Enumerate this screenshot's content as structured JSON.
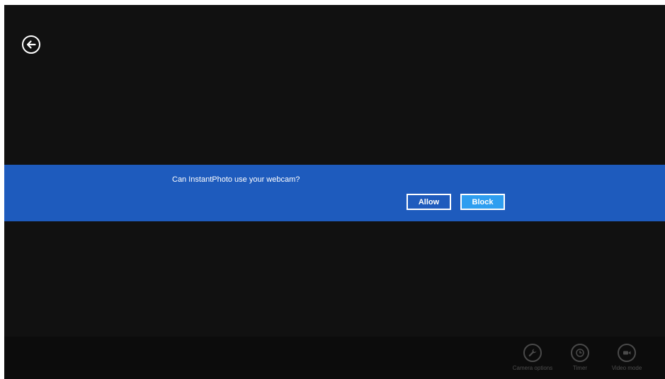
{
  "app": {
    "name": "InstantPhoto",
    "back_icon": "back-arrow-icon"
  },
  "permission_prompt": {
    "question": "Can InstantPhoto use your webcam?",
    "allow_label": "Allow",
    "block_label": "Block",
    "colors": {
      "bar": "#1e5bbd",
      "block_button": "#2e9ef0"
    }
  },
  "app_bar": {
    "commands": [
      {
        "label": "Camera options",
        "icon": "wrench-icon"
      },
      {
        "label": "Timer",
        "icon": "clock-icon"
      },
      {
        "label": "Video mode",
        "icon": "video-camera-icon"
      }
    ]
  }
}
